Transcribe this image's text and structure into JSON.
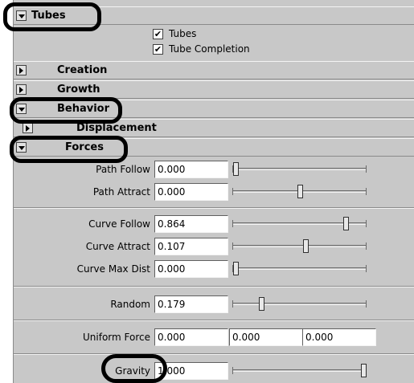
{
  "sections": {
    "tubes": "Tubes",
    "creation": "Creation",
    "growth": "Growth",
    "behavior": "Behavior",
    "displacement": "Displacement",
    "forces": "Forces"
  },
  "checkboxes": [
    {
      "label": "Tubes",
      "checked": true
    },
    {
      "label": "Tube Completion",
      "checked": true
    }
  ],
  "check_mark": "✔",
  "attributes": {
    "path_follow": {
      "label": "Path Follow",
      "value": "0.000",
      "slider": 0.0
    },
    "path_attract": {
      "label": "Path Attract",
      "value": "0.000",
      "slider": 0.5
    },
    "curve_follow": {
      "label": "Curve Follow",
      "value": "0.864",
      "slider": 0.864
    },
    "curve_attract": {
      "label": "Curve Attract",
      "value": "0.107",
      "slider": 0.55
    },
    "curve_max_dist": {
      "label": "Curve Max Dist",
      "value": "0.000",
      "slider": 0.0
    },
    "random": {
      "label": "Random",
      "value": "0.179",
      "slider": 0.2
    },
    "uniform_force": {
      "label": "Uniform Force",
      "values": [
        "0.000",
        "0.000",
        "0.000"
      ]
    },
    "gravity": {
      "label": "Gravity",
      "value": "1.000",
      "slider": 1.0
    }
  },
  "colors": {
    "panel": "#c8c8c8",
    "highlight_oval": "#000000"
  },
  "icons": {
    "collapsed": "triangle-right-icon",
    "expanded": "triangle-down-icon"
  }
}
